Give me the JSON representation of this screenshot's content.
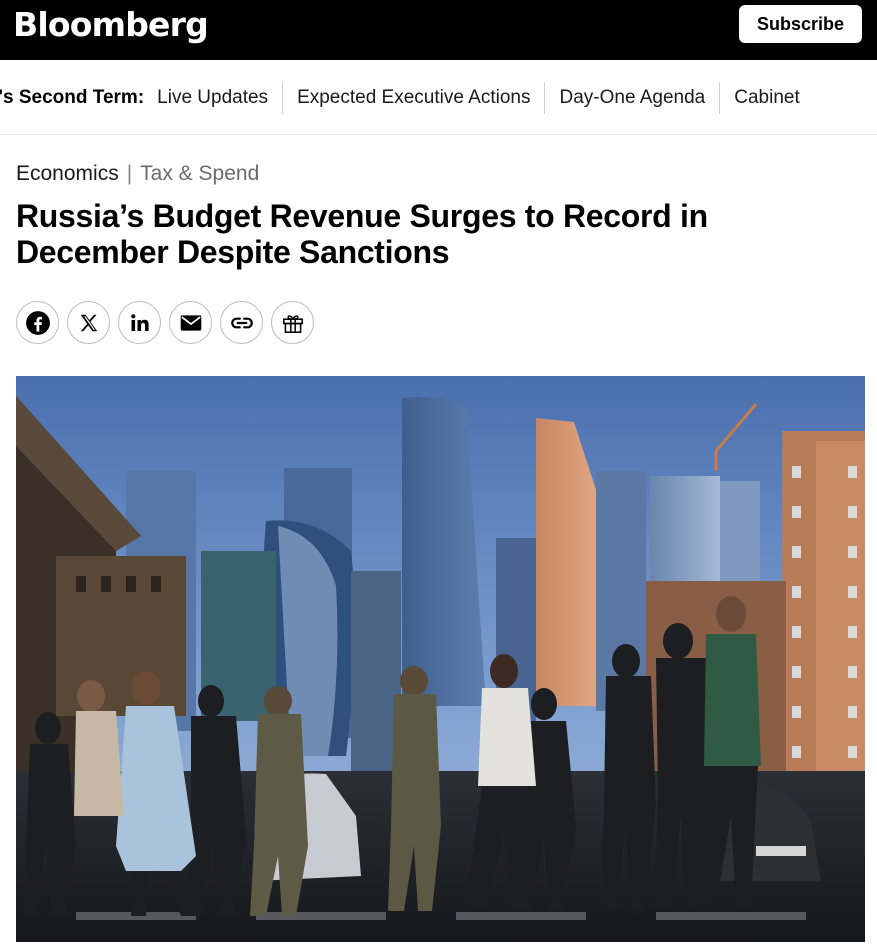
{
  "header": {
    "logo": "Bloomberg",
    "subscribe_label": "Subscribe"
  },
  "nav": {
    "label": "mp's Second Term:",
    "links": [
      "Live Updates",
      "Expected Executive Actions",
      "Day-One Agenda",
      "Cabinet"
    ]
  },
  "article": {
    "category": "Economics",
    "separator": "|",
    "subcategory": "Tax & Spend",
    "headline": "Russia’s Budget Revenue Surges to Record in December Despite Sanctions"
  },
  "share": {
    "buttons": [
      "facebook-icon",
      "x-icon",
      "linkedin-icon",
      "email-icon",
      "link-icon",
      "gift-icon"
    ]
  },
  "colors": {
    "topbar": "#000000",
    "accent": "#000000"
  }
}
